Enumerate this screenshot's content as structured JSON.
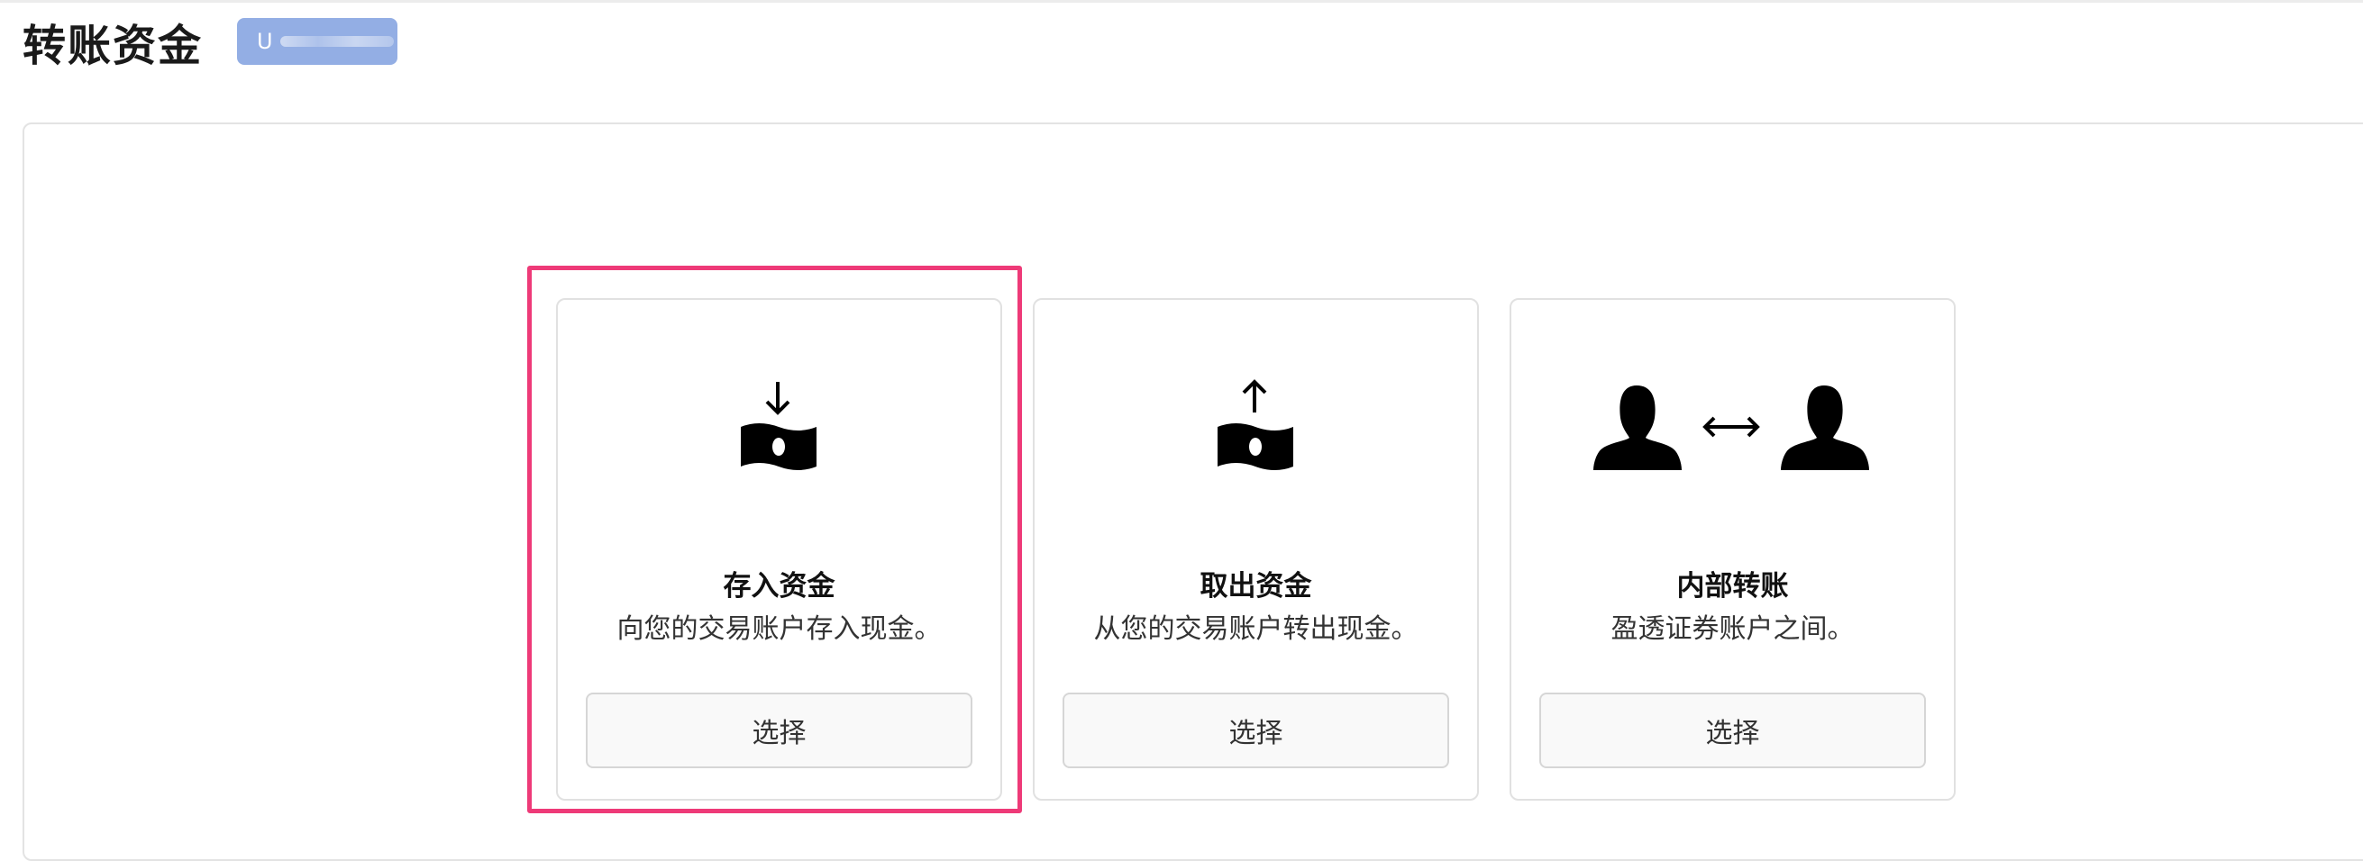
{
  "page": {
    "title": "转账资金",
    "account_badge": "U"
  },
  "cards": [
    {
      "id": "deposit",
      "icon": "money-deposit-icon",
      "title": "存入资金",
      "description": "向您的交易账户存入现金。",
      "button": "选择",
      "highlighted": true
    },
    {
      "id": "withdraw",
      "icon": "money-withdraw-icon",
      "title": "取出资金",
      "description": "从您的交易账户转出现金。",
      "button": "选择"
    },
    {
      "id": "internal",
      "icon": "user-transfer-icon",
      "title": "内部转账",
      "description": "盈透证券账户之间。",
      "button": "选择"
    }
  ],
  "colors": {
    "highlight": "#ee3a78",
    "badge": "#93aee4",
    "card_border": "#e1e1e1",
    "button_bg": "#f9f9f9"
  }
}
